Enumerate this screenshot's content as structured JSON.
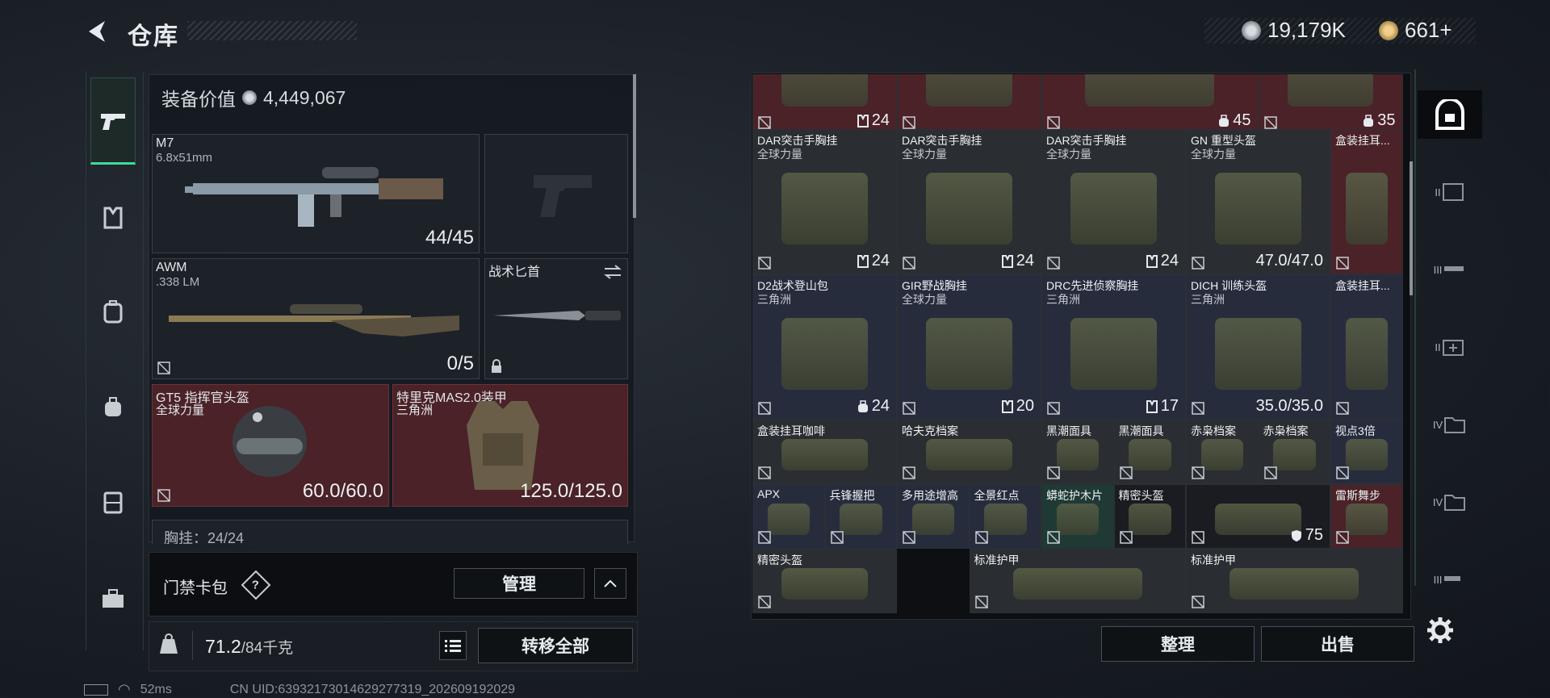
{
  "header": {
    "title": "仓库"
  },
  "currency": {
    "coins": "19,179K",
    "tickets": "661+"
  },
  "equipment": {
    "value_label": "装备价值",
    "value": "4,449,067",
    "primary": {
      "name": "M7",
      "caliber": "6.8x51mm",
      "ammo": "44/45"
    },
    "secondary": {
      "name": "AWM",
      "caliber": ".338 LM",
      "ammo": "0/5"
    },
    "melee": {
      "name": "战术匕首"
    },
    "helmet": {
      "name": "GT5 指挥官头盔",
      "source": "全球力量",
      "durability": "60.0/60.0"
    },
    "armor": {
      "name": "特里克MAS2.0装甲",
      "source": "三角洲",
      "durability": "125.0/125.0"
    },
    "rig_partial": "胸挂：24/24"
  },
  "card_bag": {
    "label": "门禁卡包",
    "help": "?",
    "manage": "管理"
  },
  "weight": {
    "current": "71.2",
    "max": "/84千克",
    "transfer_all": "转移全部"
  },
  "status": {
    "ping": "52ms",
    "uid": "CN UID:6393217301462927731​9_202609192029"
  },
  "stash_items": [
    {
      "name": "",
      "sub": "",
      "num": "24",
      "tag": "rig"
    },
    {
      "name": "",
      "sub": "",
      "num": "",
      "tag": ""
    },
    {
      "name": "",
      "sub": "",
      "num": "45",
      "tag": "bag"
    },
    {
      "name": "",
      "sub": "",
      "num": "35",
      "tag": "bag"
    },
    {
      "name": "DAR突击手胸挂",
      "sub": "全球力量",
      "num": "24",
      "tag": "rig"
    },
    {
      "name": "DAR突击手胸挂",
      "sub": "全球力量",
      "num": "24",
      "tag": "rig"
    },
    {
      "name": "DAR突击手胸挂",
      "sub": "全球力量",
      "num": "24",
      "tag": "rig"
    },
    {
      "name": "GN 重型头盔",
      "sub": "全球力量",
      "num": "47.0/47.0",
      "tag": ""
    },
    {
      "name": "盒装挂耳...",
      "sub": "",
      "num": "",
      "tag": ""
    },
    {
      "name": "D2战术登山包",
      "sub": "三角洲",
      "num": "24",
      "tag": "bag"
    },
    {
      "name": "GIR野战胸挂",
      "sub": "全球力量",
      "num": "20",
      "tag": "rig"
    },
    {
      "name": "DRC先进侦察胸挂",
      "sub": "三角洲",
      "num": "17",
      "tag": "rig"
    },
    {
      "name": "DICH 训练头盔",
      "sub": "三角洲",
      "num": "35.0/35.0",
      "tag": ""
    },
    {
      "name": "盒装挂耳...",
      "sub": "",
      "num": "",
      "tag": ""
    },
    {
      "name": "盒装挂耳咖啡",
      "sub": "",
      "num": "",
      "tag": ""
    },
    {
      "name": "哈夫克档案",
      "sub": "",
      "num": "",
      "tag": ""
    },
    {
      "name": "黑潮面具",
      "sub": "",
      "num": "",
      "tag": ""
    },
    {
      "name": "黑潮面具",
      "sub": "",
      "num": "",
      "tag": ""
    },
    {
      "name": "赤枭档案",
      "sub": "",
      "num": "",
      "tag": ""
    },
    {
      "name": "赤枭档案",
      "sub": "",
      "num": "",
      "tag": ""
    },
    {
      "name": "视点3倍",
      "sub": "",
      "num": "",
      "tag": ""
    },
    {
      "name": "APX",
      "sub": "",
      "num": "",
      "tag": ""
    },
    {
      "name": "兵锋握把",
      "sub": "",
      "num": "",
      "tag": ""
    },
    {
      "name": "多用途增高",
      "sub": "",
      "num": "",
      "tag": ""
    },
    {
      "name": "全景红点",
      "sub": "",
      "num": "",
      "tag": ""
    },
    {
      "name": "蟒蛇护木片",
      "sub": "",
      "num": "",
      "tag": ""
    },
    {
      "name": "精密头盔",
      "sub": "",
      "num": "",
      "tag": ""
    },
    {
      "name": "",
      "sub": "",
      "num": "75",
      "tag": "shield"
    },
    {
      "name": "雷斯舞步",
      "sub": "",
      "num": "",
      "tag": ""
    },
    {
      "name": "精密头盔",
      "sub": "",
      "num": "",
      "tag": ""
    },
    {
      "name": "标准护甲",
      "sub": "",
      "num": "",
      "tag": ""
    },
    {
      "name": "标准护甲",
      "sub": "",
      "num": "",
      "tag": ""
    }
  ],
  "actions": {
    "tidy": "整理",
    "sell": "出售"
  },
  "right_rail": [
    "II",
    "III",
    "II",
    "IV",
    "IV",
    "III"
  ],
  "colors": {
    "accent": "#3fd9a0",
    "rare_red": "#4a2228",
    "epic_blue": "#272c3d"
  }
}
